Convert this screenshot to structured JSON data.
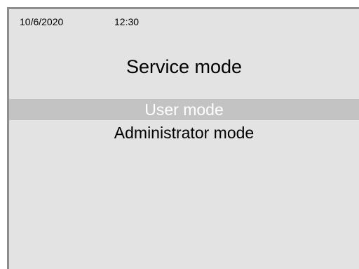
{
  "status_bar": {
    "date": "10/6/2020",
    "time": "12:30"
  },
  "title": "Service mode",
  "menu": {
    "items": [
      {
        "label": "User mode",
        "selected": true
      },
      {
        "label": "Administrator mode",
        "selected": false
      }
    ]
  },
  "colors": {
    "background": "#e3e3e3",
    "border": "#8e8e8e",
    "selection_bg": "#c3c3c3",
    "selection_text": "#ffffff"
  }
}
